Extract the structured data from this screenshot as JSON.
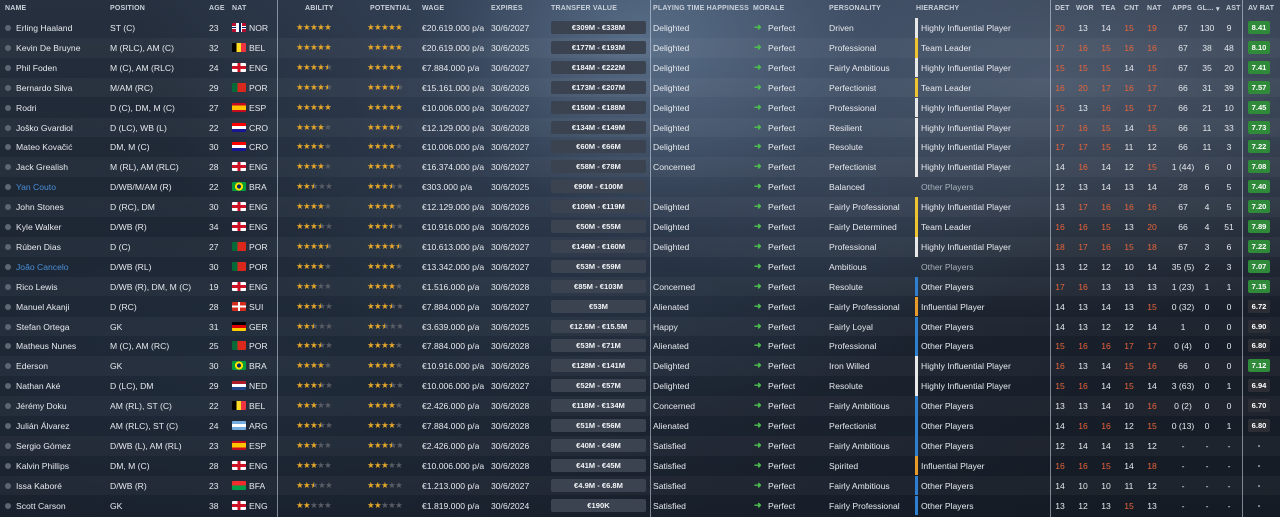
{
  "headers": {
    "name": "NAME",
    "position": "POSITION",
    "age": "AGE",
    "nat": "NAT",
    "ability": "ABILITY",
    "potential": "POTENTIAL",
    "wage": "WAGE",
    "expires": "EXPIRES",
    "transfer_value": "TRANSFER VALUE",
    "happiness": "PLAYING TIME HAPPINESS",
    "morale": "MORALE",
    "personality": "PERSONALITY",
    "hierarchy": "HIERARCHY",
    "det": "DET",
    "wor": "WOR",
    "tea": "TEA",
    "cnt": "CNT",
    "nat2": "NAT",
    "apps": "APPS",
    "gl": "GL...",
    "ast": "AST",
    "avrat": "AV RAT"
  },
  "colors": {
    "accent": "#e6a82a",
    "morale_arrow": "#4ec04e",
    "link": "#4a8fd6",
    "hier_white": "#e8e8e8",
    "hier_yellow": "#f0c330",
    "hier_blue": "#2f7fd0",
    "hier_orange": "#e89a2a",
    "rating_green": "#2f8a3a",
    "rating_dark": "#2b2f35"
  },
  "players": [
    {
      "name": "Erling Haaland",
      "pos": "ST (C)",
      "age": "23",
      "nat": "NOR",
      "flag": "nor",
      "ab": 5,
      "pot": 5,
      "wage": "€20.619.000 p/a",
      "exp": "30/6/2027",
      "val": "€309M - €338M",
      "hap": "Delighted",
      "mor": "Perfect",
      "pers": "Driven",
      "hier": "Highly Influential Player",
      "hb": "white",
      "det": "20",
      "wor": "13",
      "tea": "14",
      "cnt": "15",
      "nat2": "19",
      "apps": "67",
      "gl": "130",
      "ast": "9",
      "rat": "8.41",
      "rg": "green"
    },
    {
      "name": "Kevin De Bruyne",
      "pos": "M (RLC), AM (C)",
      "age": "32",
      "nat": "BEL",
      "flag": "bel",
      "ab": 5,
      "pot": 5,
      "wage": "€20.619.000 p/a",
      "exp": "30/6/2025",
      "val": "€177M - €193M",
      "hap": "Delighted",
      "mor": "Perfect",
      "pers": "Professional",
      "hier": "Team Leader",
      "hb": "yellow",
      "det": "17",
      "wor": "16",
      "tea": "15",
      "cnt": "16",
      "nat2": "16",
      "apps": "67",
      "gl": "38",
      "ast": "48",
      "rat": "8.10",
      "rg": "green"
    },
    {
      "name": "Phil Foden",
      "pos": "M (C), AM (RLC)",
      "age": "24",
      "nat": "ENG",
      "flag": "eng",
      "ab": 4.5,
      "pot": 5,
      "wage": "€7.884.000 p/a",
      "exp": "30/6/2027",
      "val": "€184M - €222M",
      "hap": "Delighted",
      "mor": "Perfect",
      "pers": "Fairly Ambitious",
      "hier": "Highly Influential Player",
      "hb": "white",
      "det": "15",
      "wor": "15",
      "tea": "15",
      "cnt": "14",
      "nat2": "15",
      "apps": "67",
      "gl": "35",
      "ast": "20",
      "rat": "7.41",
      "rg": "green"
    },
    {
      "name": "Bernardo Silva",
      "pos": "M/AM (RC)",
      "age": "29",
      "nat": "POR",
      "flag": "por",
      "ab": 4.5,
      "pot": 4.5,
      "wage": "€15.161.000 p/a",
      "exp": "30/6/2026",
      "val": "€173M - €207M",
      "hap": "Delighted",
      "mor": "Perfect",
      "pers": "Perfectionist",
      "hier": "Team Leader",
      "hb": "yellow",
      "det": "16",
      "wor": "20",
      "tea": "17",
      "cnt": "16",
      "nat2": "17",
      "apps": "66",
      "gl": "31",
      "ast": "39",
      "rat": "7.57",
      "rg": "green"
    },
    {
      "name": "Rodri",
      "pos": "D (C), DM, M (C)",
      "age": "27",
      "nat": "ESP",
      "flag": "esp",
      "ab": 5,
      "pot": 5,
      "wage": "€10.006.000 p/a",
      "exp": "30/6/2027",
      "val": "€150M - €188M",
      "hap": "Delighted",
      "mor": "Perfect",
      "pers": "Professional",
      "hier": "Highly Influential Player",
      "hb": "white",
      "det": "15",
      "wor": "13",
      "tea": "16",
      "cnt": "15",
      "nat2": "17",
      "apps": "66",
      "gl": "21",
      "ast": "10",
      "rat": "7.45",
      "rg": "green"
    },
    {
      "name": "Joško Gvardiol",
      "pos": "D (LC), WB (L)",
      "age": "22",
      "nat": "CRO",
      "flag": "cro",
      "ab": 4,
      "pot": 4.5,
      "wage": "€12.129.000 p/a",
      "exp": "30/6/2028",
      "val": "€134M - €149M",
      "hap": "Delighted",
      "mor": "Perfect",
      "pers": "Resilient",
      "hier": "Highly Influential Player",
      "hb": "white",
      "det": "17",
      "wor": "16",
      "tea": "15",
      "cnt": "14",
      "nat2": "15",
      "apps": "66",
      "gl": "11",
      "ast": "33",
      "rat": "7.73",
      "rg": "green"
    },
    {
      "name": "Mateo Kovačić",
      "pos": "DM, M (C)",
      "age": "30",
      "nat": "CRO",
      "flag": "cro",
      "ab": 4,
      "pot": 4,
      "wage": "€10.006.000 p/a",
      "exp": "30/6/2027",
      "val": "€60M - €66M",
      "hap": "Delighted",
      "mor": "Perfect",
      "pers": "Resolute",
      "hier": "Highly Influential Player",
      "hb": "white",
      "det": "17",
      "wor": "17",
      "tea": "15",
      "cnt": "11",
      "nat2": "12",
      "apps": "66",
      "gl": "11",
      "ast": "3",
      "rat": "7.22",
      "rg": "green"
    },
    {
      "name": "Jack Grealish",
      "pos": "M (RL), AM (RLC)",
      "age": "28",
      "nat": "ENG",
      "flag": "eng",
      "ab": 4,
      "pot": 4,
      "wage": "€16.374.000 p/a",
      "exp": "30/6/2027",
      "val": "€58M - €78M",
      "hap": "Concerned",
      "mor": "Perfect",
      "pers": "Perfectionist",
      "hier": "Highly Influential Player",
      "hb": "white",
      "det": "14",
      "wor": "16",
      "tea": "14",
      "cnt": "12",
      "nat2": "15",
      "apps": "1 (44)",
      "gl": "6",
      "ast": "0",
      "rat": "7.08",
      "rg": "green"
    },
    {
      "name": "Yan Couto",
      "pos": "D/WB/M/AM (R)",
      "age": "22",
      "nat": "BRA",
      "flag": "bra",
      "ab": 2.5,
      "pot": 3.5,
      "wage": "€303.000 p/a",
      "exp": "30/6/2025",
      "val": "€90M - €100M",
      "hap": "",
      "mor": "Perfect",
      "pers": "Balanced",
      "hier": "Other Players",
      "hb": "none",
      "det": "12",
      "wor": "13",
      "tea": "14",
      "cnt": "13",
      "nat2": "14",
      "apps": "28",
      "gl": "6",
      "ast": "5",
      "rat": "7.40",
      "rg": "green",
      "link": true
    },
    {
      "name": "John Stones",
      "pos": "D (RC), DM",
      "age": "30",
      "nat": "ENG",
      "flag": "eng",
      "ab": 4,
      "pot": 4,
      "wage": "€12.129.000 p/a",
      "exp": "30/6/2026",
      "val": "€109M - €119M",
      "hap": "Delighted",
      "mor": "Perfect",
      "pers": "Fairly Professional",
      "hier": "Highly Influential Player",
      "hb": "yellow",
      "det": "13",
      "wor": "17",
      "tea": "16",
      "cnt": "16",
      "nat2": "16",
      "apps": "67",
      "gl": "4",
      "ast": "5",
      "rat": "7.20",
      "rg": "green"
    },
    {
      "name": "Kyle Walker",
      "pos": "D/WB (R)",
      "age": "34",
      "nat": "ENG",
      "flag": "eng",
      "ab": 3.5,
      "pot": 3.5,
      "wage": "€10.916.000 p/a",
      "exp": "30/6/2026",
      "val": "€50M - €55M",
      "hap": "Delighted",
      "mor": "Perfect",
      "pers": "Fairly Determined",
      "hier": "Team Leader",
      "hb": "yellow",
      "det": "16",
      "wor": "16",
      "tea": "15",
      "cnt": "13",
      "nat2": "20",
      "apps": "66",
      "gl": "4",
      "ast": "51",
      "rat": "7.89",
      "rg": "green"
    },
    {
      "name": "Rúben Dias",
      "pos": "D (C)",
      "age": "27",
      "nat": "POR",
      "flag": "por",
      "ab": 4.5,
      "pot": 4.5,
      "wage": "€10.613.000 p/a",
      "exp": "30/6/2027",
      "val": "€146M - €160M",
      "hap": "Delighted",
      "mor": "Perfect",
      "pers": "Professional",
      "hier": "Highly Influential Player",
      "hb": "white",
      "det": "18",
      "wor": "17",
      "tea": "16",
      "cnt": "15",
      "nat2": "18",
      "apps": "67",
      "gl": "3",
      "ast": "6",
      "rat": "7.22",
      "rg": "green"
    },
    {
      "name": "João Cancelo",
      "pos": "D/WB (RL)",
      "age": "30",
      "nat": "POR",
      "flag": "por",
      "ab": 4,
      "pot": 4,
      "wage": "€13.342.000 p/a",
      "exp": "30/6/2027",
      "val": "€53M - €59M",
      "hap": "",
      "mor": "Perfect",
      "pers": "Ambitious",
      "hier": "Other Players",
      "hb": "none",
      "det": "13",
      "wor": "12",
      "tea": "12",
      "cnt": "10",
      "nat2": "14",
      "apps": "35 (5)",
      "gl": "2",
      "ast": "3",
      "rat": "7.07",
      "rg": "green",
      "link": true
    },
    {
      "name": "Rico Lewis",
      "pos": "D/WB (R), DM, M (C)",
      "age": "19",
      "nat": "ENG",
      "flag": "eng",
      "ab": 3,
      "pot": 4,
      "wage": "€1.516.000 p/a",
      "exp": "30/6/2028",
      "val": "€85M - €103M",
      "hap": "Concerned",
      "mor": "Perfect",
      "pers": "Resolute",
      "hier": "Other Players",
      "hb": "blue",
      "det": "17",
      "wor": "16",
      "tea": "13",
      "cnt": "13",
      "nat2": "13",
      "apps": "1 (23)",
      "gl": "1",
      "ast": "1",
      "rat": "7.15",
      "rg": "green"
    },
    {
      "name": "Manuel Akanji",
      "pos": "D (RC)",
      "age": "28",
      "nat": "SUI",
      "flag": "sui",
      "ab": 3.5,
      "pot": 3.5,
      "wage": "€7.884.000 p/a",
      "exp": "30/6/2027",
      "val": "€53M",
      "hap": "Alienated",
      "mor": "Perfect",
      "pers": "Fairly Professional",
      "hier": "Influential Player",
      "hb": "orange",
      "det": "14",
      "wor": "13",
      "tea": "14",
      "cnt": "13",
      "nat2": "15",
      "apps": "0 (32)",
      "gl": "0",
      "ast": "0",
      "rat": "6.72",
      "rg": "dark"
    },
    {
      "name": "Stefan Ortega",
      "pos": "GK",
      "age": "31",
      "nat": "GER",
      "flag": "ger",
      "ab": 2.5,
      "pot": 2.5,
      "wage": "€3.639.000 p/a",
      "exp": "30/6/2025",
      "val": "€12.5M - €15.5M",
      "hap": "Happy",
      "mor": "Perfect",
      "pers": "Fairly Loyal",
      "hier": "Other Players",
      "hb": "blue",
      "det": "14",
      "wor": "13",
      "tea": "12",
      "cnt": "12",
      "nat2": "14",
      "apps": "1",
      "gl": "0",
      "ast": "0",
      "rat": "6.90",
      "rg": "dark"
    },
    {
      "name": "Matheus Nunes",
      "pos": "M (C), AM (RC)",
      "age": "25",
      "nat": "POR",
      "flag": "por",
      "ab": 3.5,
      "pot": 4,
      "wage": "€7.884.000 p/a",
      "exp": "30/6/2028",
      "val": "€53M - €71M",
      "hap": "Alienated",
      "mor": "Perfect",
      "pers": "Professional",
      "hier": "Other Players",
      "hb": "blue",
      "det": "15",
      "wor": "16",
      "tea": "16",
      "cnt": "17",
      "nat2": "17",
      "apps": "0 (4)",
      "gl": "0",
      "ast": "0",
      "rat": "6.80",
      "rg": "dark"
    },
    {
      "name": "Ederson",
      "pos": "GK",
      "age": "30",
      "nat": "BRA",
      "flag": "bra",
      "ab": 4,
      "pot": 4,
      "wage": "€10.916.000 p/a",
      "exp": "30/6/2026",
      "val": "€128M - €141M",
      "hap": "Delighted",
      "mor": "Perfect",
      "pers": "Iron Willed",
      "hier": "Highly Influential Player",
      "hb": "white",
      "det": "16",
      "wor": "13",
      "tea": "14",
      "cnt": "15",
      "nat2": "16",
      "apps": "66",
      "gl": "0",
      "ast": "0",
      "rat": "7.12",
      "rg": "green"
    },
    {
      "name": "Nathan Aké",
      "pos": "D (LC), DM",
      "age": "29",
      "nat": "NED",
      "flag": "ned",
      "ab": 3.5,
      "pot": 3.5,
      "wage": "€10.006.000 p/a",
      "exp": "30/6/2027",
      "val": "€52M - €57M",
      "hap": "Delighted",
      "mor": "Perfect",
      "pers": "Resolute",
      "hier": "Highly Influential Player",
      "hb": "white",
      "det": "15",
      "wor": "16",
      "tea": "14",
      "cnt": "15",
      "nat2": "14",
      "apps": "3 (63)",
      "gl": "0",
      "ast": "1",
      "rat": "6.94",
      "rg": "dark"
    },
    {
      "name": "Jérémy Doku",
      "pos": "AM (RL), ST (C)",
      "age": "22",
      "nat": "BEL",
      "flag": "bel",
      "ab": 3,
      "pot": 4,
      "wage": "€2.426.000 p/a",
      "exp": "30/6/2028",
      "val": "€118M - €134M",
      "hap": "Concerned",
      "mor": "Perfect",
      "pers": "Fairly Ambitious",
      "hier": "Other Players",
      "hb": "blue",
      "det": "13",
      "wor": "13",
      "tea": "14",
      "cnt": "10",
      "nat2": "16",
      "apps": "0 (2)",
      "gl": "0",
      "ast": "0",
      "rat": "6.70",
      "rg": "dark"
    },
    {
      "name": "Julián Álvarez",
      "pos": "AM (RLC), ST (C)",
      "age": "24",
      "nat": "ARG",
      "flag": "arg",
      "ab": 3.5,
      "pot": 4,
      "wage": "€7.884.000 p/a",
      "exp": "30/6/2028",
      "val": "€51M - €56M",
      "hap": "Alienated",
      "mor": "Perfect",
      "pers": "Perfectionist",
      "hier": "Other Players",
      "hb": "blue",
      "det": "14",
      "wor": "16",
      "tea": "16",
      "cnt": "12",
      "nat2": "15",
      "apps": "0 (13)",
      "gl": "0",
      "ast": "1",
      "rat": "6.80",
      "rg": "dark"
    },
    {
      "name": "Sergio Gómez",
      "pos": "D/WB (L), AM (RL)",
      "age": "23",
      "nat": "ESP",
      "flag": "esp",
      "ab": 3,
      "pot": 3.5,
      "wage": "€2.426.000 p/a",
      "exp": "30/6/2026",
      "val": "€40M - €49M",
      "hap": "Satisfied",
      "mor": "Perfect",
      "pers": "Fairly Ambitious",
      "hier": "Other Players",
      "hb": "blue",
      "det": "12",
      "wor": "14",
      "tea": "14",
      "cnt": "13",
      "nat2": "12",
      "apps": "-",
      "gl": "-",
      "ast": "-",
      "rat": "-",
      "rg": "none"
    },
    {
      "name": "Kalvin Phillips",
      "pos": "DM, M (C)",
      "age": "28",
      "nat": "ENG",
      "flag": "eng",
      "ab": 3,
      "pot": 3,
      "wage": "€10.006.000 p/a",
      "exp": "30/6/2028",
      "val": "€41M - €45M",
      "hap": "Satisfied",
      "mor": "Perfect",
      "pers": "Spirited",
      "hier": "Influential Player",
      "hb": "orange",
      "det": "16",
      "wor": "16",
      "tea": "15",
      "cnt": "14",
      "nat2": "18",
      "apps": "-",
      "gl": "-",
      "ast": "-",
      "rat": "-",
      "rg": "none"
    },
    {
      "name": "Issa Kaboré",
      "pos": "D/WB (R)",
      "age": "23",
      "nat": "BFA",
      "flag": "bfa",
      "ab": 2.5,
      "pot": 3,
      "wage": "€1.213.000 p/a",
      "exp": "30/6/2027",
      "val": "€4.9M - €6.8M",
      "hap": "Satisfied",
      "mor": "Perfect",
      "pers": "Fairly Ambitious",
      "hier": "Other Players",
      "hb": "blue",
      "det": "14",
      "wor": "10",
      "tea": "10",
      "cnt": "11",
      "nat2": "12",
      "apps": "-",
      "gl": "-",
      "ast": "-",
      "rat": "-",
      "rg": "none"
    },
    {
      "name": "Scott Carson",
      "pos": "GK",
      "age": "38",
      "nat": "ENG",
      "flag": "eng",
      "ab": 2,
      "pot": 2,
      "wage": "€1.819.000 p/a",
      "exp": "30/6/2024",
      "val": "€190K",
      "hap": "Satisfied",
      "mor": "Perfect",
      "pers": "Fairly Professional",
      "hier": "Other Players",
      "hb": "blue",
      "det": "13",
      "wor": "12",
      "tea": "13",
      "cnt": "15",
      "nat2": "13",
      "apps": "-",
      "gl": "-",
      "ast": "-",
      "rat": "-",
      "rg": "none"
    }
  ]
}
